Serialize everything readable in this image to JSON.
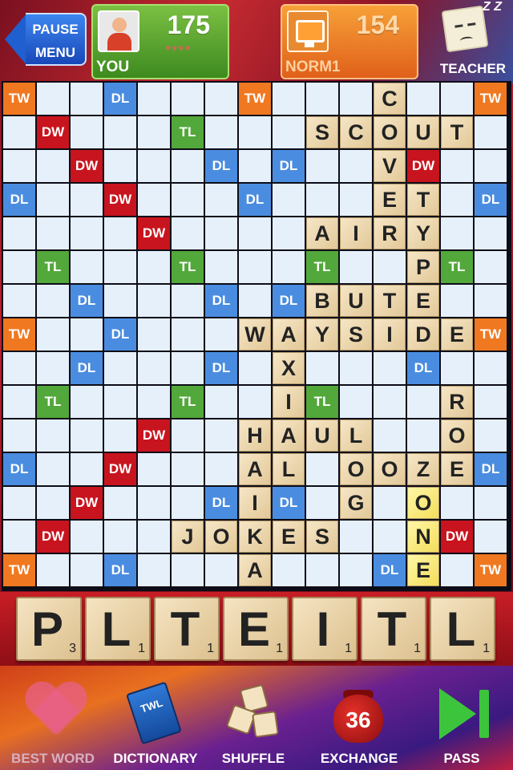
{
  "header": {
    "pause_label_1": "PAUSE",
    "pause_label_2": "MENU",
    "you": {
      "name": "YOU",
      "score": "175",
      "hearts": "♥♥♥♥"
    },
    "opponent": {
      "name": "NORM1",
      "score": "154"
    },
    "teacher_label": "TEACHER",
    "teacher_zzz": "Z Z"
  },
  "board": {
    "size": 15,
    "rows": [
      [
        "TW",
        "",
        "",
        "DL",
        "",
        "",
        "",
        "TW",
        "",
        "",
        "",
        "c:C",
        "",
        "",
        "TW"
      ],
      [
        "",
        "DW",
        "",
        "",
        "",
        "TL",
        "",
        "",
        "",
        "t:S",
        "t:C",
        "t:O",
        "t:U",
        "t:T",
        ""
      ],
      [
        "",
        "",
        "DW",
        "",
        "",
        "",
        "DL",
        "",
        "DL",
        "",
        "",
        "t:V",
        "DW",
        "",
        ""
      ],
      [
        "DL",
        "",
        "",
        "DW",
        "",
        "",
        "",
        "DL",
        "",
        "",
        "",
        "t:E",
        "t:T",
        "",
        "DL"
      ],
      [
        "",
        "",
        "",
        "",
        "DW",
        "",
        "",
        "",
        "",
        "t:A",
        "t:I",
        "t:R",
        "t:Y",
        "",
        ""
      ],
      [
        "",
        "TL",
        "",
        "",
        "",
        "TL",
        "",
        "",
        "",
        "TL",
        "",
        "",
        "t:P",
        "TL",
        ""
      ],
      [
        "",
        "",
        "DL",
        "",
        "",
        "",
        "DL",
        "",
        "DL",
        "t:B",
        "t:U",
        "t:T",
        "t:E",
        "",
        ""
      ],
      [
        "TW",
        "",
        "",
        "DL",
        "",
        "",
        "",
        "t:W",
        "t:A",
        "t:Y",
        "t:S",
        "t:I",
        "t:D",
        "t:E",
        "TW"
      ],
      [
        "",
        "",
        "DL",
        "",
        "",
        "",
        "DL",
        "",
        "t:X",
        "",
        "",
        "",
        "DL",
        "",
        ""
      ],
      [
        "",
        "TL",
        "",
        "",
        "",
        "TL",
        "",
        "",
        "t:I",
        "TL",
        "",
        "",
        "",
        "t:R",
        ""
      ],
      [
        "",
        "",
        "",
        "",
        "DW",
        "",
        "",
        "t:H",
        "t:A",
        "t:U",
        "t:L",
        "",
        "",
        "t:O",
        ""
      ],
      [
        "DL",
        "",
        "",
        "DW",
        "",
        "",
        "",
        "t:A",
        "t:L",
        "",
        "t:O",
        "t:O",
        "t:Z",
        "t:E",
        "DL"
      ],
      [
        "",
        "",
        "DW",
        "",
        "",
        "",
        "DL",
        "t:I",
        "DL",
        "",
        "t:G",
        "",
        "n:O",
        "",
        ""
      ],
      [
        "",
        "DW",
        "",
        "",
        "",
        "t:J",
        "t:O",
        "t:K",
        "t:E",
        "t:S",
        "",
        "",
        "n:N",
        "DW",
        ""
      ],
      [
        "TW",
        "",
        "",
        "DL",
        "",
        "",
        "",
        "t:A",
        "",
        "",
        "",
        "DL",
        "n:E",
        "",
        "TW"
      ]
    ]
  },
  "rack": {
    "tiles": [
      {
        "letter": "P",
        "points": "3"
      },
      {
        "letter": "L",
        "points": "1"
      },
      {
        "letter": "T",
        "points": "1"
      },
      {
        "letter": "E",
        "points": "1"
      },
      {
        "letter": "I",
        "points": "1"
      },
      {
        "letter": "T",
        "points": "1"
      },
      {
        "letter": "L",
        "points": "1"
      }
    ]
  },
  "toolbar": {
    "best_word": "BEST WORD",
    "dictionary": "DICTIONARY",
    "dictionary_book": "TWL",
    "shuffle": "SHUFFLE",
    "exchange": "EXCHANGE",
    "bag_count": "36",
    "pass": "PASS"
  }
}
